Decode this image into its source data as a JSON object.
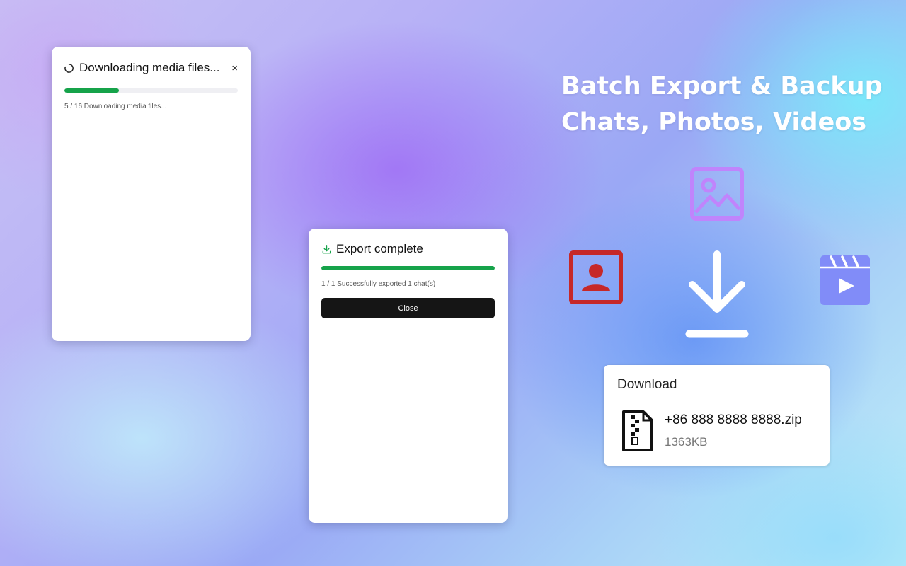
{
  "left_dialog": {
    "title": "Downloading media files...",
    "status": "5 / 16 Downloading media files...",
    "progress_fraction": 0.3125,
    "close_glyph": "×"
  },
  "mid_dialog": {
    "title": "Export complete",
    "status": "1 / 1 Successfully exported 1 chat(s)",
    "progress_fraction": 1.0,
    "close_button": "Close"
  },
  "headline": {
    "line1": "Batch Export & Backup",
    "line2": "Chats, Photos, Videos"
  },
  "download_card": {
    "title": "Download",
    "file_name": "+86 888 8888 8888.zip",
    "file_size": "1363KB"
  },
  "icons": {
    "image": "image-icon",
    "contact": "contact-icon",
    "video": "video-clapper-icon",
    "download": "download-arrow-icon",
    "zip": "zip-file-icon"
  },
  "colors": {
    "progress": "#16a34a",
    "image_icon": "#c084fc",
    "contact_icon": "#c62828",
    "video_icon": "#818cf8",
    "button_bg": "#151515"
  }
}
